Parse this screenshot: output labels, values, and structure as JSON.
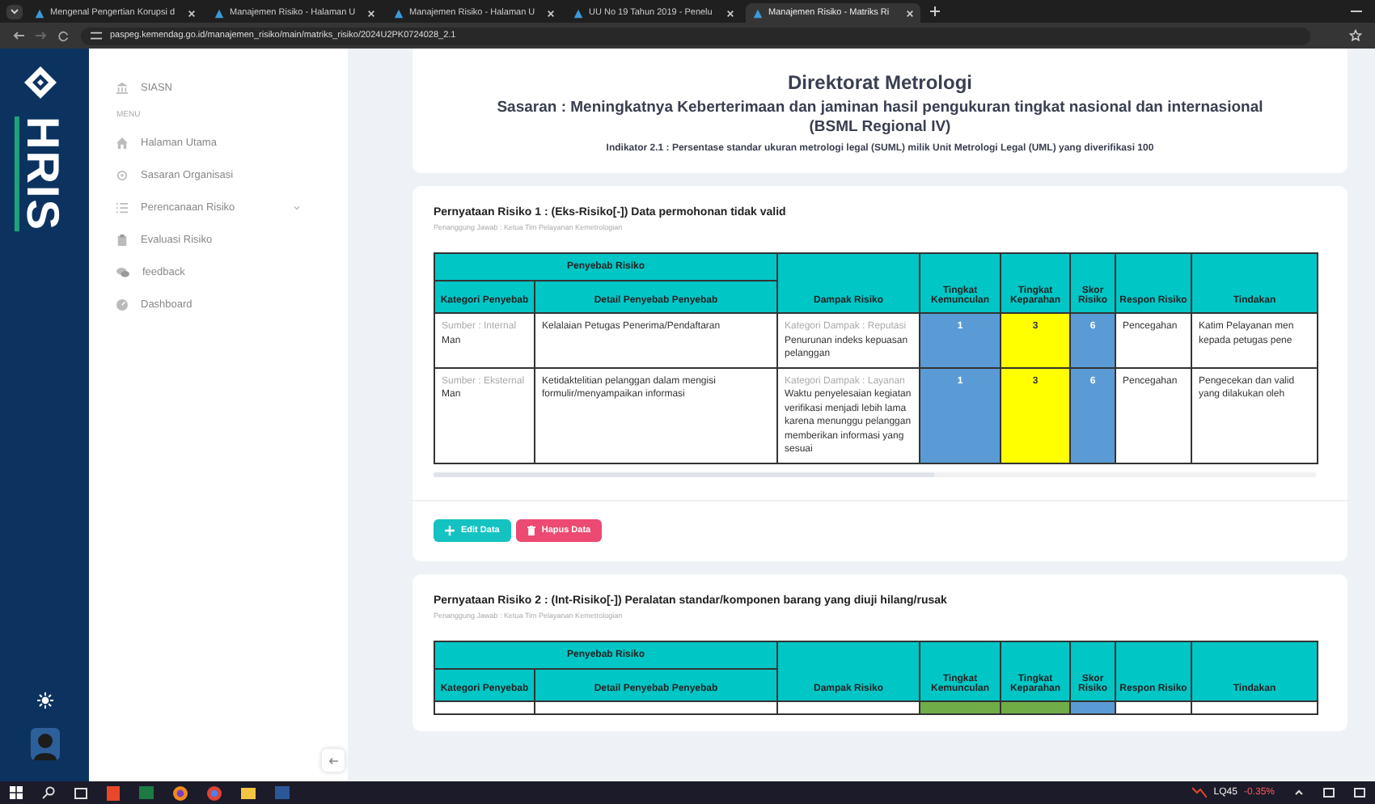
{
  "browser": {
    "tabs": [
      {
        "title": "Mengenal Pengertian Korupsi d",
        "selected": false
      },
      {
        "title": "Manajemen Risiko - Halaman U",
        "selected": false
      },
      {
        "title": "Manajemen Risiko - Halaman U",
        "selected": false
      },
      {
        "title": "UU No 19 Tahun 2019 - Penelu",
        "selected": false
      },
      {
        "title": "Manajemen Risiko - Matriks Ri",
        "selected": true
      }
    ],
    "url": "paspeg.kemendag.go.id/manajemen_risiko/main/matriks_risiko/2024U2PK0724028_2.1"
  },
  "brand": "HRIS",
  "sidebar": {
    "app": "SIASN",
    "section": "MENU",
    "items": [
      {
        "label": "Halaman Utama",
        "kind": "home",
        "expandable": false
      },
      {
        "label": "Sasaran Organisasi",
        "kind": "target",
        "expandable": false
      },
      {
        "label": "Perencanaan Risiko",
        "kind": "list",
        "expandable": true
      },
      {
        "label": "Evaluasi Risiko",
        "kind": "clipboard",
        "expandable": false
      },
      {
        "label": "feedback",
        "kind": "chat",
        "expandable": false
      },
      {
        "label": "Dashboard",
        "kind": "gauge",
        "expandable": false
      }
    ]
  },
  "header": {
    "title": "Direktorat Metrologi",
    "sasaran": "Sasaran : Meningkatnya Keberterimaan dan jaminan hasil pengukuran tingkat nasional dan internasional (BSML Regional IV)",
    "indikator": "Indikator 2.1 : Persentase standar ukuran metrologi legal (SUML) milik Unit Metrologi Legal (UML) yang diverifikasi 100"
  },
  "risks": [
    {
      "statement": "Pernyataan Risiko 1 : (Eks-Risiko[-]) Data permohonan tidak valid",
      "owner": "Penanggung Jawab : Ketua Tim Pelayanan Kemetrologian",
      "group": "Penyebab Risiko",
      "columns": [
        "Kategori Penyebab",
        "Detail Penyebab Penyebab",
        "Dampak Risiko",
        "Tingkat Kemunculan",
        "Tingkat Keparahan",
        "Skor Risiko",
        "Respon Risiko",
        "Tindakan"
      ],
      "rows": [
        {
          "source": "Sumber : Internal",
          "category": "Man",
          "detail": "Kelalaian Petugas Penerima/Pendaftaran",
          "impact_category": "Kategori Dampak : Reputasi",
          "impact": "Penurunan indeks kepuasan pelanggan",
          "levels": [
            {
              "value": "1",
              "color": "#5b9bd5"
            },
            {
              "value": "3",
              "color": "#ffff00"
            },
            {
              "value": "6",
              "color": "#5b9bd5"
            }
          ],
          "response": "Pencegahan",
          "action_lines": [
            "Katim Pelayanan men",
            "kepada petugas pene"
          ]
        },
        {
          "source": "Sumber : Eksternal",
          "category": "Man",
          "detail": "Ketidaktelitian pelanggan dalam mengisi formulir/menyampaikan informasi",
          "impact_category": "Kategori Dampak : Layanan",
          "impact": "Waktu penyelesaian kegiatan verifikasi menjadi lebih lama karena menunggu pelanggan memberikan informasi yang sesuai",
          "levels": [
            {
              "value": "1",
              "color": "#5b9bd5"
            },
            {
              "value": "3",
              "color": "#ffff00"
            },
            {
              "value": "6",
              "color": "#5b9bd5"
            }
          ],
          "response": "Pencegahan",
          "action_lines": [
            "Pengecekan dan valid",
            "yang dilakukan oleh"
          ]
        }
      ],
      "buttons": [
        {
          "label": "Edit Data",
          "kind": "edit"
        },
        {
          "label": "Hapus Data",
          "kind": "delete"
        }
      ]
    },
    {
      "statement": "Pernyataan Risiko 2 : (Int-Risiko[-]) Peralatan standar/komponen barang yang diuji hilang/rusak",
      "owner": "Penanggung Jawab : Ketua Tim Pelayanan Kemetrologian",
      "group": "Penyebab Risiko",
      "columns": [
        "Kategori Penyebab",
        "Detail Penyebab Penyebab",
        "Dampak Risiko",
        "Tingkat Kemunculan",
        "Tingkat Keparahan",
        "Skor Risiko",
        "Respon Risiko",
        "Tindakan"
      ],
      "rows": [
        {
          "levels": [
            {
              "color": "#70ad47"
            },
            {
              "color": "#70ad47"
            },
            {
              "color": "#5b9bd5"
            }
          ]
        }
      ]
    }
  ],
  "taskbar": {
    "ticker": "LQ45",
    "change": "-0.35%"
  }
}
